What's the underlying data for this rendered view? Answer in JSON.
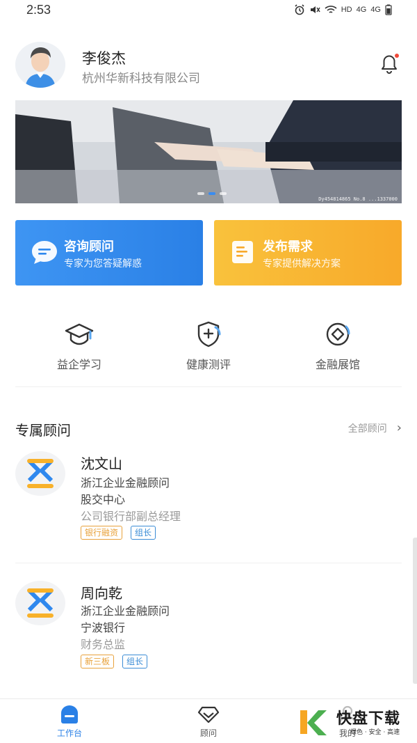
{
  "status": {
    "time": "2:53",
    "icons": [
      "alarm-icon",
      "mute-icon",
      "wifi-icon",
      "HD",
      "4G",
      "4G",
      "battery-icon"
    ]
  },
  "profile": {
    "name": "李俊杰",
    "company": "杭州华新科技有限公司"
  },
  "banner": {
    "watermark": "Dy454814865 No.8 ...1337000",
    "active_dot": 1,
    "dot_count": 3
  },
  "actions": [
    {
      "title": "咨询顾问",
      "subtitle": "专家为您答疑解惑",
      "color": "#2f88ee"
    },
    {
      "title": "发布需求",
      "subtitle": "专家提供解决方案",
      "color": "#f9b232"
    }
  ],
  "features": [
    {
      "label": "益企学习",
      "icon": "graduation-cap-icon"
    },
    {
      "label": "健康测评",
      "icon": "shield-plus-icon"
    },
    {
      "label": "金融展馆",
      "icon": "finance-eye-icon"
    }
  ],
  "advisors_section": {
    "title": "专属顾问",
    "all_link": "全部顾问"
  },
  "advisors": [
    {
      "name": "沈文山",
      "role": "浙江企业金融顾问",
      "org": "股交中心",
      "position": "公司银行部副总经理",
      "tags": [
        "银行融资",
        "组长"
      ]
    },
    {
      "name": "周向乾",
      "role": "浙江企业金融顾问",
      "org": "宁波银行",
      "position": "财务总监",
      "tags": [
        "新三板",
        "组长"
      ]
    }
  ],
  "tabbar": [
    {
      "label": "工作台",
      "icon": "workbench-icon",
      "active": true
    },
    {
      "label": "顾问",
      "icon": "diamond-heart-icon",
      "active": false
    },
    {
      "label": "我的",
      "icon": "person-icon",
      "active": false
    }
  ],
  "watermark": {
    "brand": "快盘下载",
    "tagline": "绿色 · 安全 · 高速"
  },
  "colors": {
    "accent_blue": "#2a80e6",
    "accent_orange": "#f8a92a",
    "tag_orange": "#e8a13a",
    "tag_blue": "#3a8cd6"
  }
}
